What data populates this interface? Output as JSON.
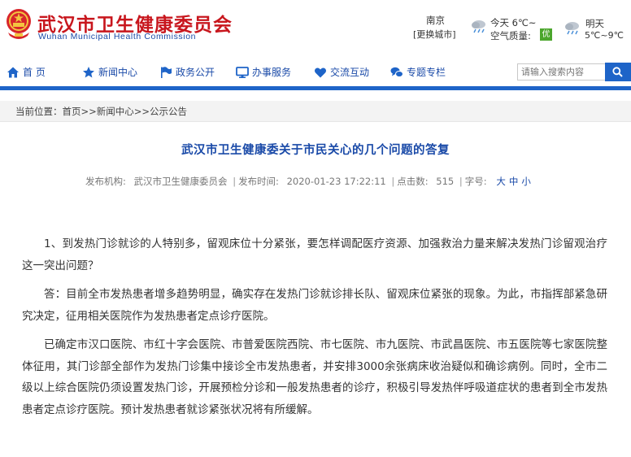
{
  "header": {
    "site_title": "武汉市卫生健康委员会",
    "site_subtitle": "Wuhan Municipal Health Commission",
    "city": "南京",
    "city_switch": "[更换城市]",
    "today_label": "今天 6℃~",
    "air_quality_label": "空气质量:",
    "air_quality_value": "优",
    "tomorrow_label": "明天",
    "tomorrow_temp": "5℃~9℃"
  },
  "nav": {
    "items": [
      {
        "label": "首 页",
        "icon": "home-icon"
      },
      {
        "label": "新闻中心",
        "icon": "star-icon"
      },
      {
        "label": "政务公开",
        "icon": "flag-icon"
      },
      {
        "label": "办事服务",
        "icon": "monitor-icon"
      },
      {
        "label": "交流互动",
        "icon": "heart-icon"
      },
      {
        "label": "专题专栏",
        "icon": "chat-bubbles-icon"
      }
    ],
    "search_placeholder": "请输入搜索内容"
  },
  "breadcrumb": "当前位置：首页>>新闻中心>>公示公告",
  "article": {
    "title": "武汉市卫生健康委关于市民关心的几个问题的答复",
    "publisher_label": "发布机构:",
    "publisher": "武汉市卫生健康委员会",
    "time_label": "发布时间:",
    "time": "2020-01-23 17:22:11",
    "clicks_label": "点击数:",
    "clicks": "515",
    "font_label": "字号:",
    "font_sizes": [
      "大",
      "中",
      "小"
    ],
    "paragraphs": [
      "1、到发热门诊就诊的人特别多，留观床位十分紧张，要怎样调配医疗资源、加强救治力量来解决发热门诊留观治疗这一突出问题？",
      "答：目前全市发热患者增多趋势明显，确实存在发热门诊就诊排长队、留观床位紧张的现象。为此，市指挥部紧急研究决定，征用相关医院作为发热患者定点诊疗医院。",
      "已确定市汉口医院、市红十字会医院、市普爱医院西院、市七医院、市九医院、市武昌医院、市五医院等七家医院整体征用，其门诊部全部作为发热门诊集中接诊全市发热患者，并安排3000余张病床收治疑似和确诊病例。同时，全市二级以上综合医院仍须设置发热门诊，开展预检分诊和一般发热患者的诊疗，积极引导发热伴呼吸道症状的患者到全市发热患者定点诊疗医院。预计发热患者就诊紧张状况将有所缓解。"
    ]
  },
  "colors": {
    "brand_red": "#c8161d",
    "brand_blue": "#1e64c8",
    "link_blue": "#1a4aa8"
  }
}
